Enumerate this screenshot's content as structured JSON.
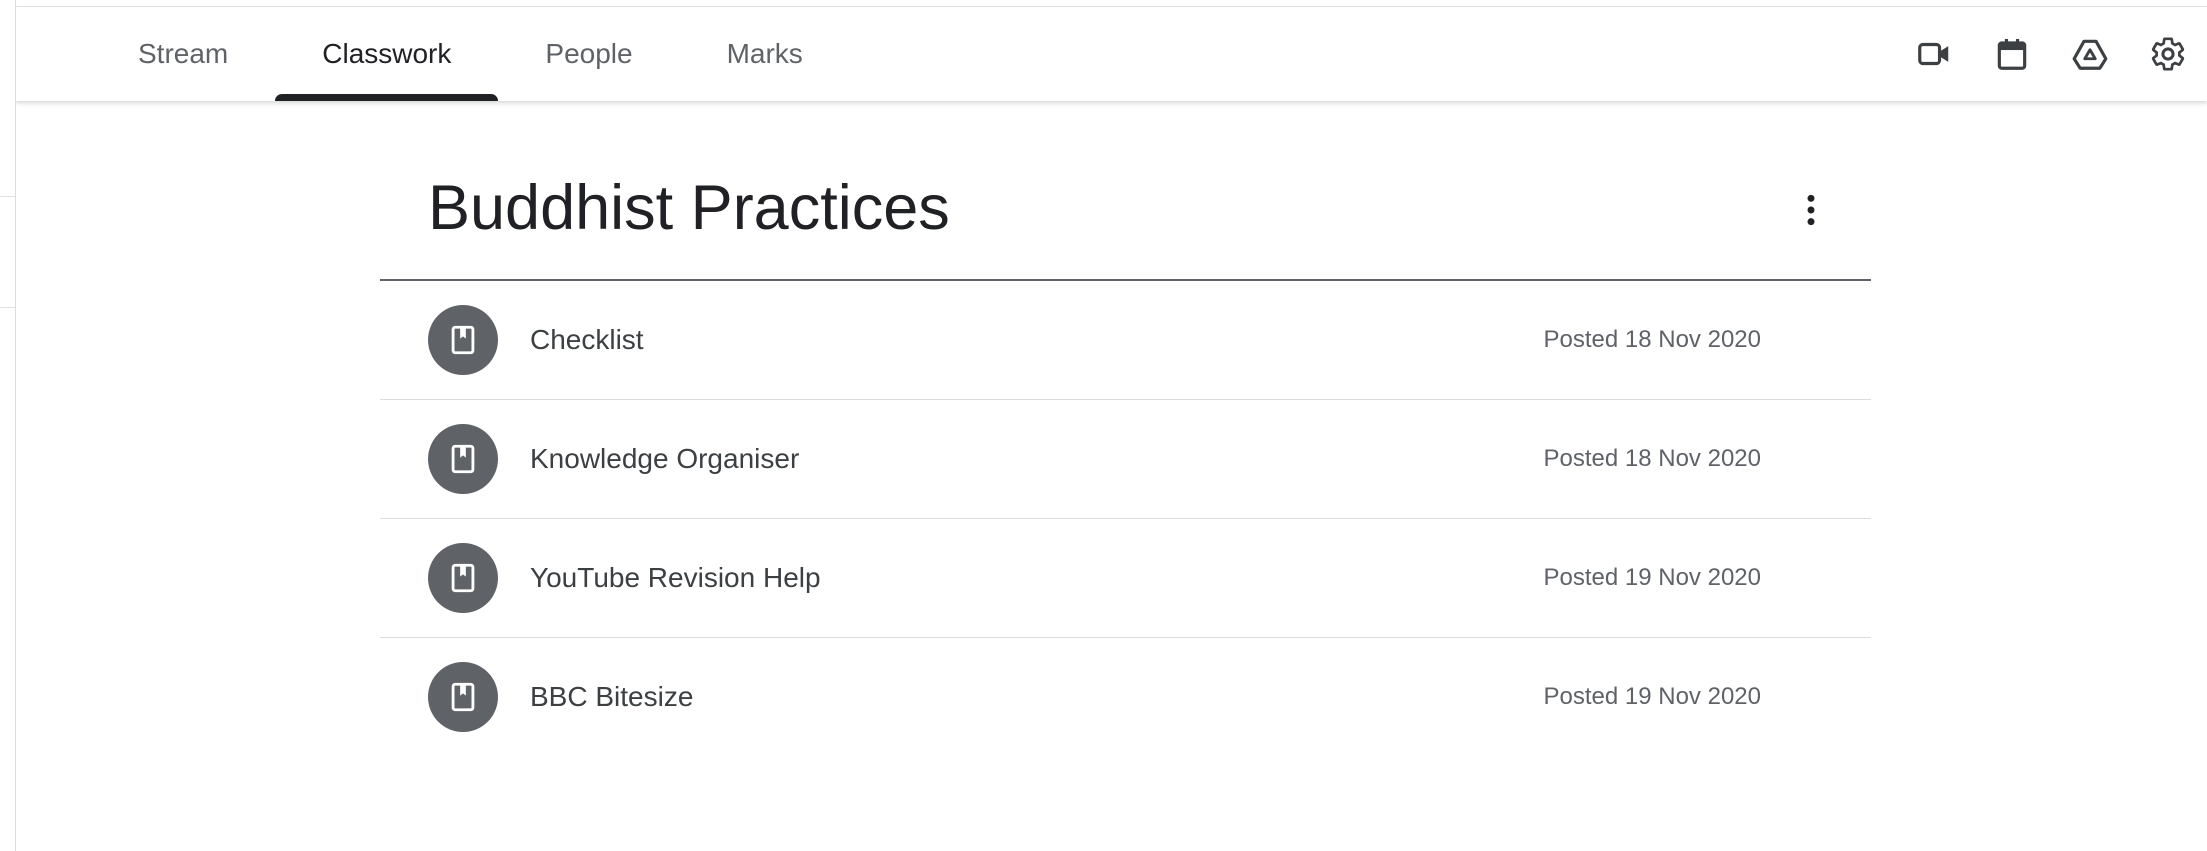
{
  "tabs": [
    {
      "label": "Stream",
      "active": false
    },
    {
      "label": "Classwork",
      "active": true
    },
    {
      "label": "People",
      "active": false
    },
    {
      "label": "Marks",
      "active": false
    }
  ],
  "tools": [
    "video-camera-icon",
    "calendar-icon",
    "drive-icon",
    "settings-icon"
  ],
  "topic": {
    "title": "Buddhist Practices",
    "items": [
      {
        "title": "Checklist",
        "posted": "Posted 18 Nov 2020",
        "icon": "material-icon"
      },
      {
        "title": "Knowledge Organiser",
        "posted": "Posted 18 Nov 2020",
        "icon": "material-icon"
      },
      {
        "title": "YouTube Revision Help",
        "posted": "Posted 19 Nov 2020",
        "icon": "material-icon"
      },
      {
        "title": "BBC Bitesize",
        "posted": "Posted 19 Nov 2020",
        "icon": "material-icon"
      }
    ]
  },
  "colors": {
    "text_primary": "#202124",
    "text_secondary": "#5f6368",
    "icon_circle": "#5f6368",
    "divider": "#dadce0"
  }
}
